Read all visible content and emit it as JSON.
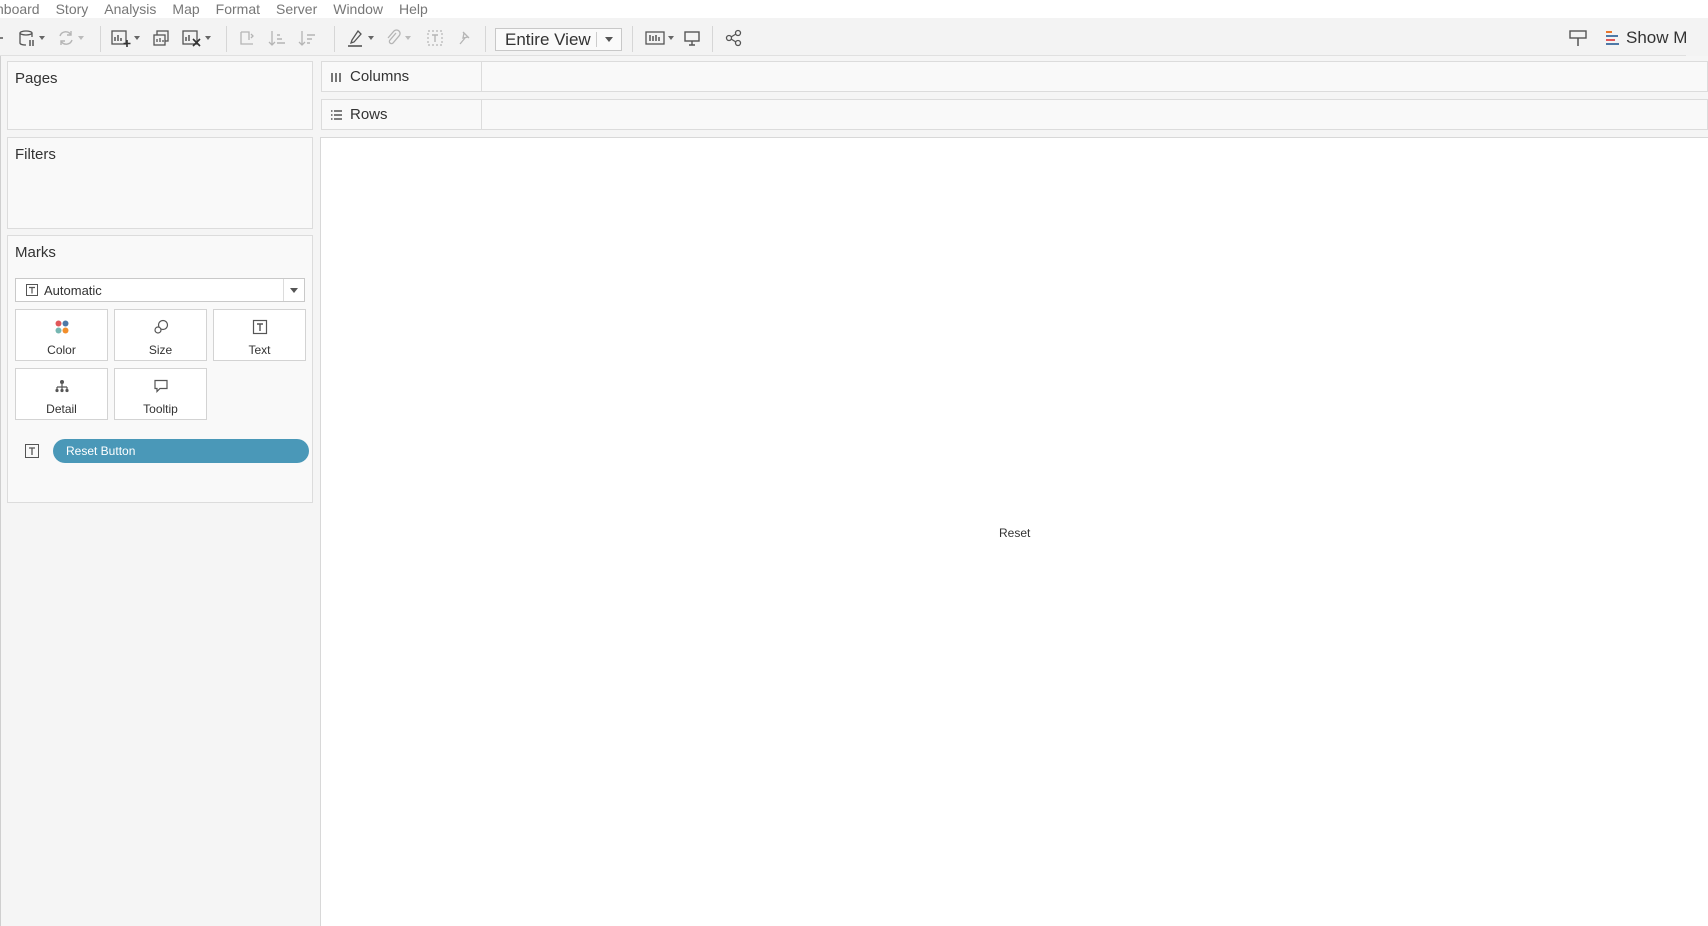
{
  "menu": {
    "items": [
      "nboard",
      "Story",
      "Analysis",
      "Map",
      "Format",
      "Server",
      "Window",
      "Help"
    ]
  },
  "toolbar": {
    "fit_value": "Entire View",
    "show_me_label": "Show M"
  },
  "panels": {
    "pages_title": "Pages",
    "filters_title": "Filters",
    "marks_title": "Marks"
  },
  "marks": {
    "mark_type": "Automatic",
    "buttons": {
      "color": "Color",
      "size": "Size",
      "text": "Text",
      "detail": "Detail",
      "tooltip": "Tooltip"
    },
    "pill": "Reset Button",
    "pill_color": "#4a98b8"
  },
  "shelves": {
    "columns": "Columns",
    "rows": "Rows"
  },
  "view": {
    "text": "Reset"
  }
}
